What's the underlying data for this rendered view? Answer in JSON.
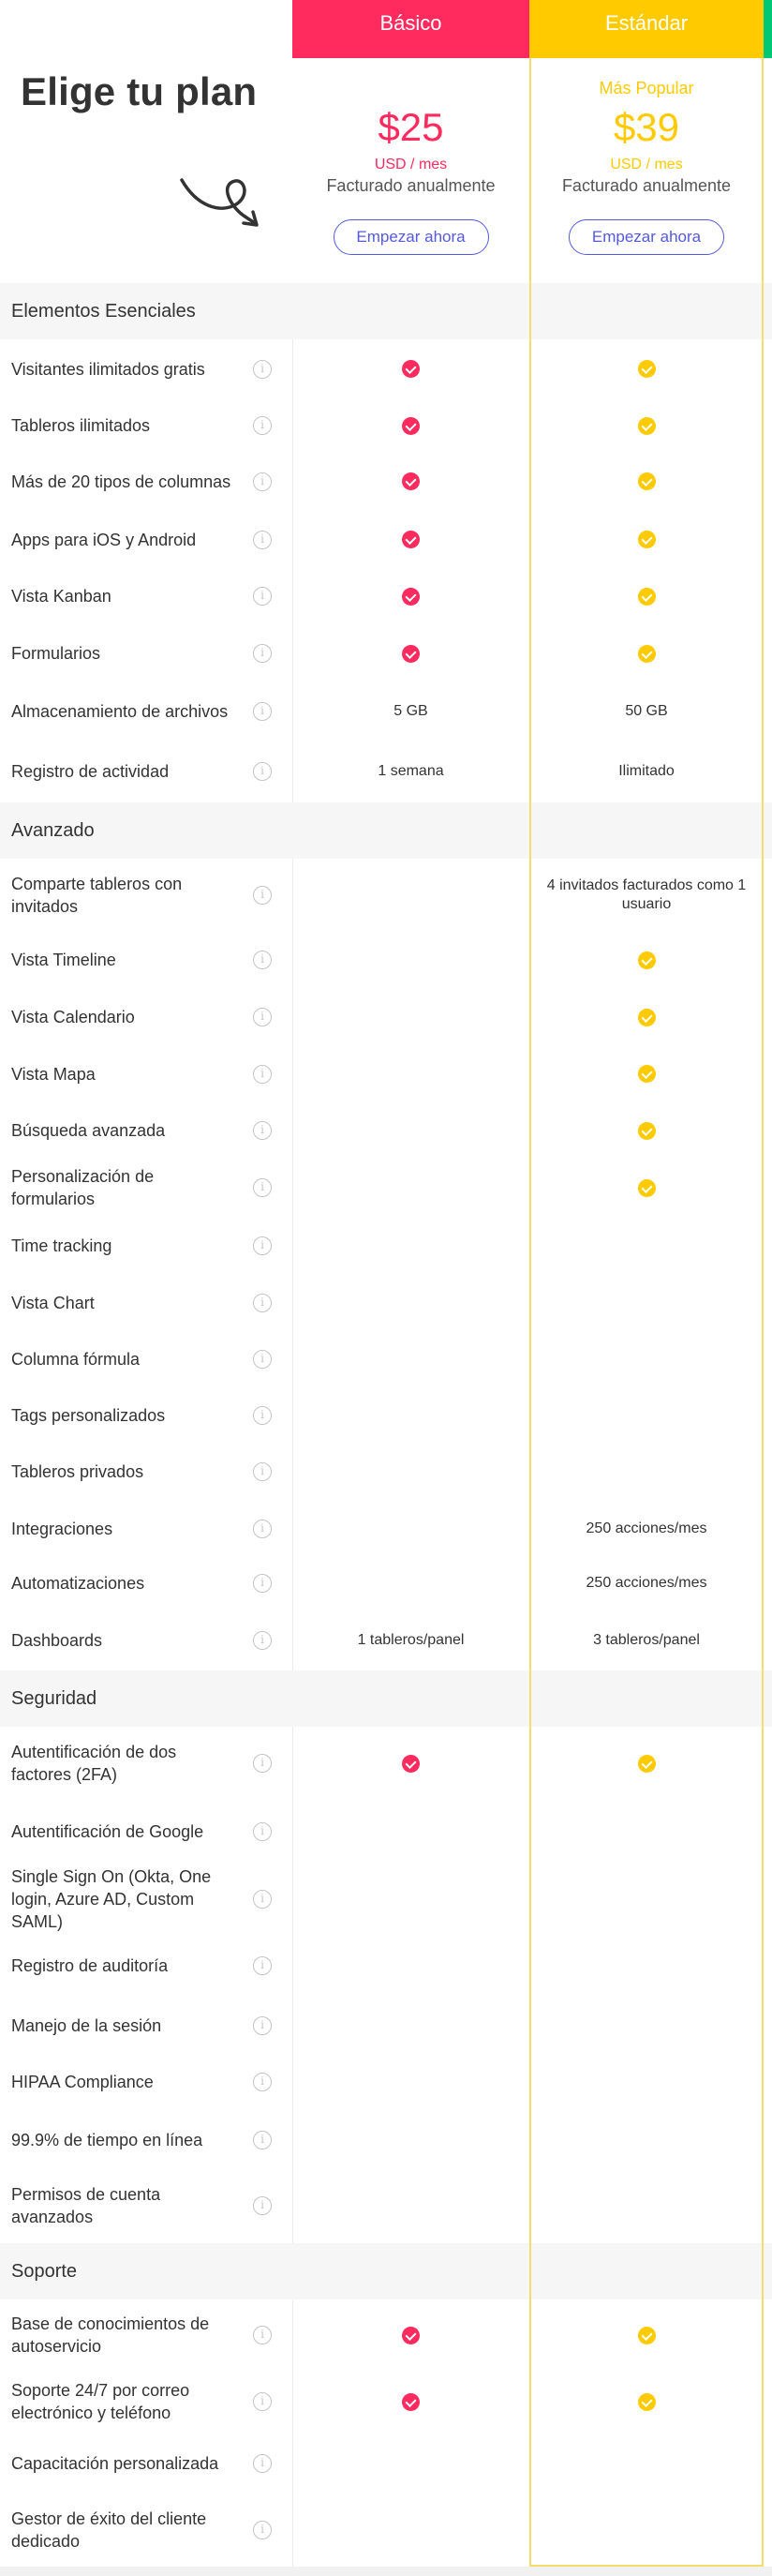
{
  "header": {
    "title": "Elige tu plan",
    "plans": {
      "basico": {
        "name": "Básico",
        "price": "$25",
        "unit": "USD / mes",
        "billing": "Facturado anualmente",
        "cta": "Empezar ahora",
        "color": "#ff2b5e"
      },
      "estandar": {
        "name": "Estándar",
        "badge": "Más Popular",
        "price": "$39",
        "unit": "USD / mes",
        "billing": "Facturado anualmente",
        "cta": "Empezar ahora",
        "color": "#ffcb00"
      }
    },
    "next_plan_color": "#00c875"
  },
  "info_icon": "i",
  "sections": [
    {
      "title": "Elementos Esenciales",
      "rows": [
        {
          "label": "Visitantes ilimitados gratis",
          "basico": "check",
          "estandar": "check"
        },
        {
          "label": "Tableros ilimitados",
          "basico": "check",
          "estandar": "check"
        },
        {
          "label": "Más de 20 tipos de columnas",
          "basico": "check",
          "estandar": "check"
        },
        {
          "label": "Apps para iOS y Android",
          "basico": "check",
          "estandar": "check"
        },
        {
          "label": "Vista Kanban",
          "basico": "check",
          "estandar": "check"
        },
        {
          "label": "Formularios",
          "basico": "check",
          "estandar": "check"
        },
        {
          "label": "Almacenamiento de archivos",
          "basico": "5 GB",
          "estandar": "50 GB"
        },
        {
          "label": "Registro de actividad",
          "basico": "1 semana",
          "estandar": "Ilimitado"
        }
      ]
    },
    {
      "title": "Avanzado",
      "rows": [
        {
          "label": "Comparte tableros con invitados",
          "basico": "",
          "estandar": "4 invitados facturados como 1 usuario"
        },
        {
          "label": "Vista Timeline",
          "basico": "",
          "estandar": "check"
        },
        {
          "label": "Vista Calendario",
          "basico": "",
          "estandar": "check"
        },
        {
          "label": "Vista Mapa",
          "basico": "",
          "estandar": "check"
        },
        {
          "label": "Búsqueda avanzada",
          "basico": "",
          "estandar": "check"
        },
        {
          "label": "Personalización de formularios",
          "basico": "",
          "estandar": "check"
        },
        {
          "label": "Time tracking",
          "basico": "",
          "estandar": ""
        },
        {
          "label": "Vista Chart",
          "basico": "",
          "estandar": ""
        },
        {
          "label": "Columna fórmula",
          "basico": "",
          "estandar": ""
        },
        {
          "label": "Tags personalizados",
          "basico": "",
          "estandar": ""
        },
        {
          "label": "Tableros privados",
          "basico": "",
          "estandar": ""
        },
        {
          "label": "Integraciones",
          "basico": "",
          "estandar": "250 acciones/mes"
        },
        {
          "label": "Automatizaciones",
          "basico": "",
          "estandar": "250 acciones/mes"
        },
        {
          "label": "Dashboards",
          "basico": "1 tableros/panel",
          "estandar": "3 tableros/panel"
        }
      ]
    },
    {
      "title": "Seguridad",
      "rows": [
        {
          "label": "Autentificación de dos factores (2FA)",
          "basico": "check",
          "estandar": "check"
        },
        {
          "label": "Autentificación de Google",
          "basico": "",
          "estandar": ""
        },
        {
          "label": "Single Sign On (Okta, One login, Azure AD, Custom SAML)",
          "basico": "",
          "estandar": ""
        },
        {
          "label": "Registro de auditoría",
          "basico": "",
          "estandar": ""
        },
        {
          "label": "Manejo de la sesión",
          "basico": "",
          "estandar": ""
        },
        {
          "label": "HIPAA Compliance",
          "basico": "",
          "estandar": ""
        },
        {
          "label": "99.9% de tiempo en línea",
          "basico": "",
          "estandar": ""
        },
        {
          "label": "Permisos de cuenta avanzados",
          "basico": "",
          "estandar": ""
        }
      ]
    },
    {
      "title": "Soporte",
      "rows": [
        {
          "label": "Base de conocimientos de autoservicio",
          "basico": "check",
          "estandar": "check"
        },
        {
          "label": "Soporte 24/7 por correo electrónico y teléfono",
          "basico": "check",
          "estandar": "check"
        },
        {
          "label": "Capacitación personalizada",
          "basico": "",
          "estandar": ""
        },
        {
          "label": "Gestor de éxito del cliente dedicado",
          "basico": "",
          "estandar": ""
        }
      ]
    }
  ]
}
